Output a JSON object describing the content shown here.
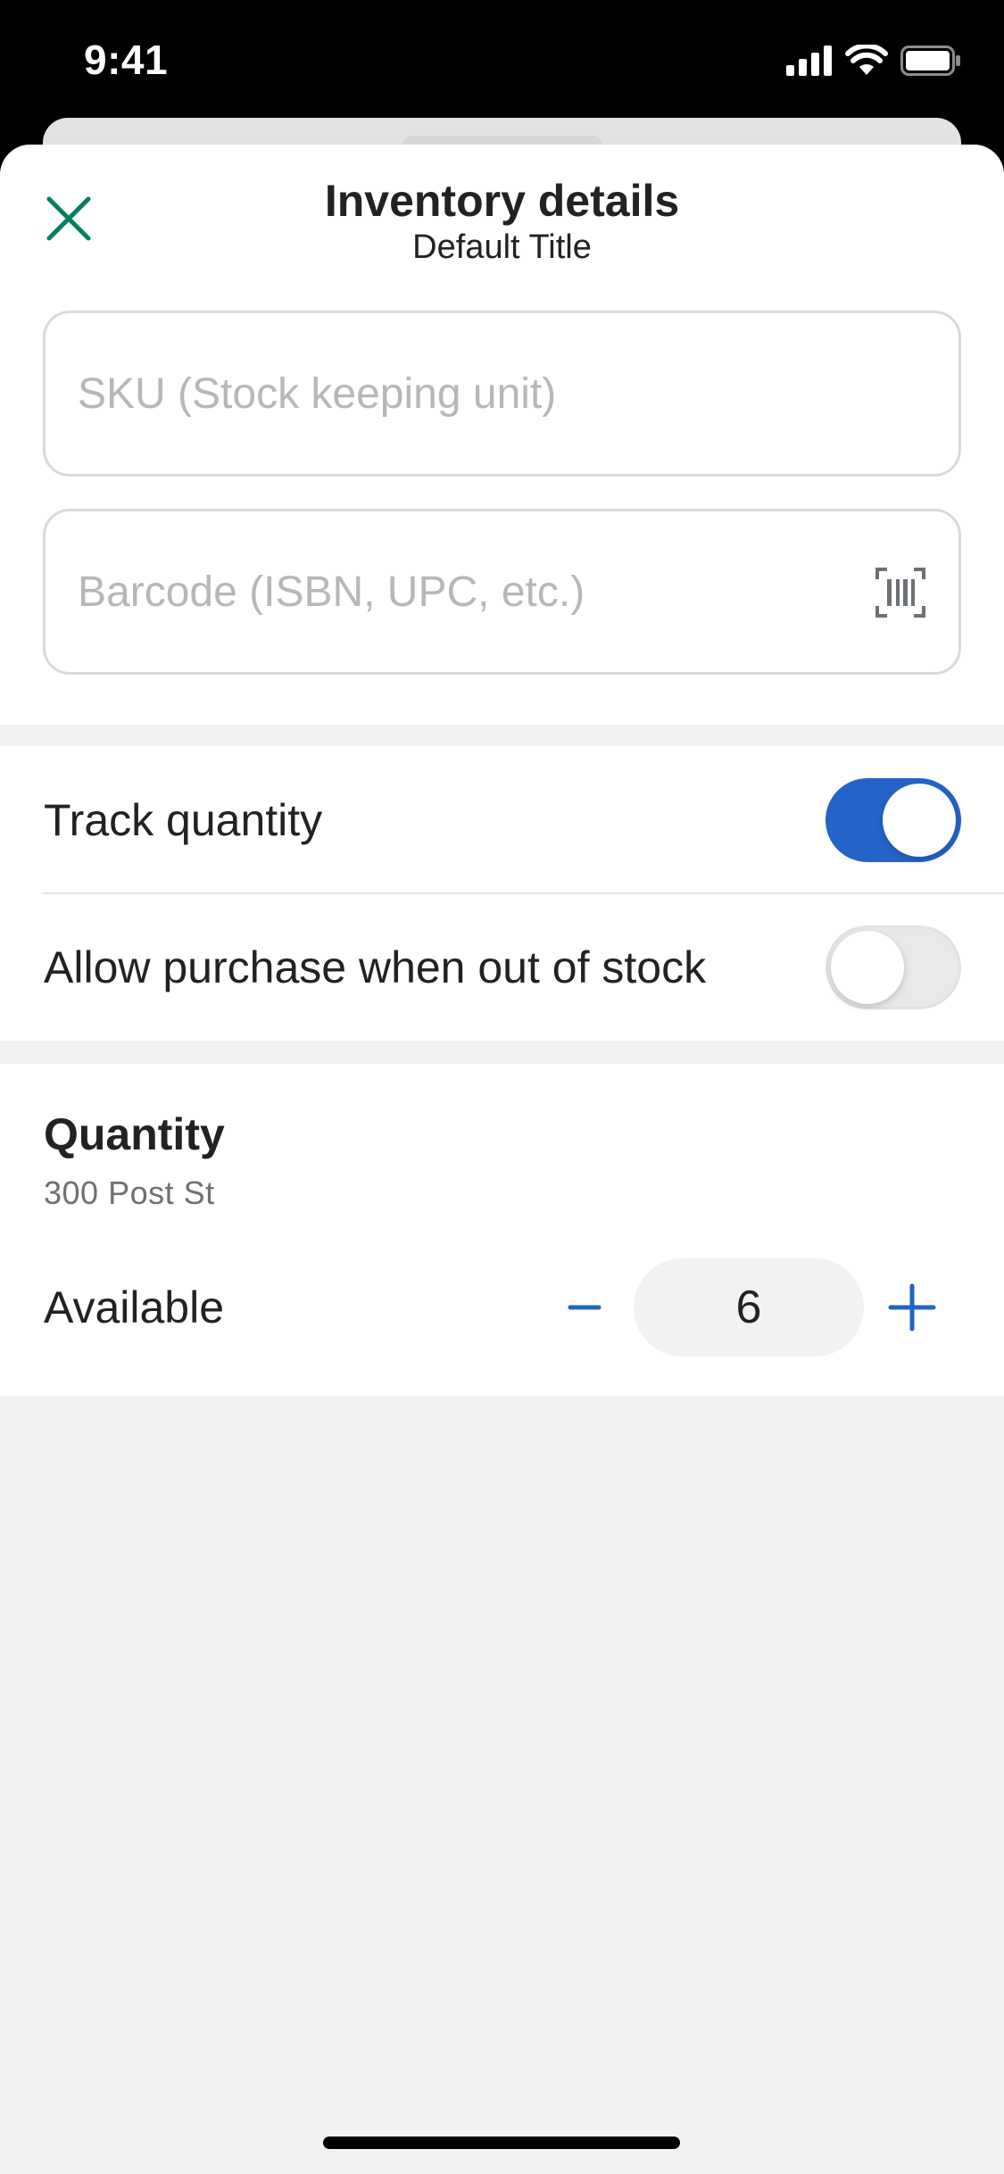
{
  "status_bar": {
    "time": "9:41",
    "icons": [
      "cellular-signal-icon",
      "wifi-icon",
      "battery-icon"
    ]
  },
  "header": {
    "title": "Inventory details",
    "subtitle": "Default Title",
    "close_icon": "close-icon"
  },
  "fields": {
    "sku": {
      "placeholder": "SKU (Stock keeping unit)",
      "value": ""
    },
    "barcode": {
      "placeholder": "Barcode (ISBN, UPC, etc.)",
      "value": "",
      "icon": "barcode-scan-icon"
    }
  },
  "toggles": {
    "track_quantity": {
      "label": "Track quantity",
      "on": true
    },
    "allow_oversell": {
      "label": "Allow purchase when out of stock",
      "on": false
    }
  },
  "quantity": {
    "heading": "Quantity",
    "location": "300 Post St",
    "available_label": "Available",
    "available_value": "6"
  },
  "colors": {
    "accent_close": "#008060",
    "toggle_on": "#2463c8",
    "stepper": "#2463c8",
    "background": "#f1f2f4"
  }
}
